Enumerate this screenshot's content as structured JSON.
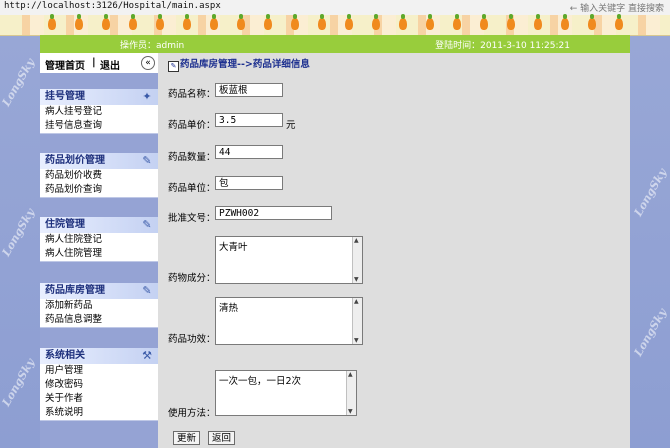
{
  "browser": {
    "address": "http://localhost:3126/Hospital/main.aspx",
    "search_hint": "← 输入关键字  直接搜索"
  },
  "header": {
    "operator": "操作员：admin",
    "login_time": "登陆时间：2011-3-10 11:25:21"
  },
  "watermark": "LongSky",
  "menu": {
    "home": "管理首页",
    "sep": "|",
    "exit": "退出",
    "collapse": "«",
    "groups": [
      {
        "title": "挂号管理",
        "icon": "register-icon",
        "items": [
          "病人挂号登记",
          "挂号信息查询"
        ]
      },
      {
        "title": "药品划价管理",
        "icon": "edit-icon",
        "items": [
          "药品划价收费",
          "药品划价查询"
        ]
      },
      {
        "title": "住院管理",
        "icon": "edit-icon",
        "items": [
          "病人住院登记",
          "病人住院管理"
        ]
      },
      {
        "title": "药品库房管理",
        "icon": "edit-icon",
        "items": [
          "添加新药品",
          "药品信息调整"
        ]
      },
      {
        "title": "系统相关",
        "icon": "tools-icon",
        "items": [
          "用户管理",
          "修改密码",
          "关于作者",
          "系统说明"
        ]
      }
    ]
  },
  "breadcrumb": "药品库房管理-->药品详细信息",
  "form": {
    "name_label": "药品名称：",
    "name_value": "板蓝根",
    "price_label": "药品单价：",
    "price_value": "3.5",
    "price_unit": "元",
    "qty_label": "药品数量：",
    "qty_value": "44",
    "unit_label": "药品单位：",
    "unit_value": "包",
    "approval_label": "批准文号：",
    "approval_value": "PZWH002",
    "ingredient_label": "药物成分：",
    "ingredient_value": "大青叶",
    "effect_label": "药品功效：",
    "effect_value": "清热",
    "usage_label": "使用方法：",
    "usage_value": "一次一包，一日2次",
    "update_button": "更新",
    "back_button": "返回"
  },
  "colors": {
    "header_green": "#98cd3c",
    "side_blue": "#95a3d4",
    "content_gray": "#dedede"
  }
}
